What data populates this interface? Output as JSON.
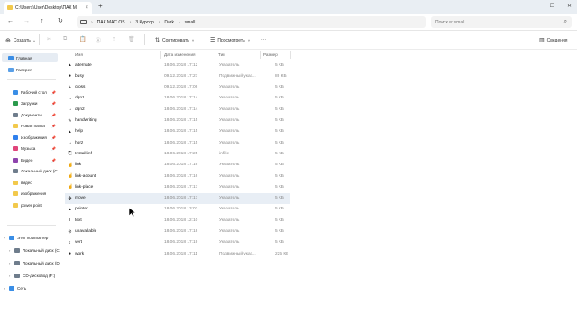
{
  "window": {
    "tab_title": "C:\\Users\\User\\Desktop\\ПАК M",
    "tab_close": "×",
    "new_tab": "+",
    "controls": [
      "—",
      "☐",
      "✕"
    ]
  },
  "address": {
    "breadcrumbs": [
      "ПАК MAC OS",
      "3 Курсор",
      "Dark",
      "small"
    ],
    "search_placeholder": "Поиск в: small"
  },
  "toolbar": {
    "create_label": "Создать",
    "sort_label": "Сортировать",
    "view_label": "Просмотреть",
    "more_label": "···",
    "details_label": "Сведения"
  },
  "sidebar": {
    "quick": [
      {
        "label": "Главная",
        "icon": "home-icon",
        "active": true
      },
      {
        "label": "Галерея",
        "icon": "gallery-icon",
        "active": false
      }
    ],
    "pinned": [
      {
        "label": "Рабочий стол",
        "icon": "desktop-icon",
        "color": "#3a8ee6"
      },
      {
        "label": "Загрузки",
        "icon": "download-icon",
        "color": "#2b9a4d"
      },
      {
        "label": "Документы",
        "icon": "documents-icon",
        "color": "#6f7d8c"
      },
      {
        "label": "Новая папка",
        "icon": "folder-icon",
        "color": "#f2c94c"
      },
      {
        "label": "Изображения",
        "icon": "pictures-icon",
        "color": "#2f80ed"
      },
      {
        "label": "Музыка",
        "icon": "music-icon",
        "color": "#e0457b"
      },
      {
        "label": "Видео",
        "icon": "video-icon",
        "color": "#8e44ad"
      },
      {
        "label": "Локальный диск (C",
        "icon": "drive-icon",
        "color": "#6f7d8c"
      },
      {
        "label": "видео",
        "icon": "folder-icon",
        "color": "#f2c94c"
      },
      {
        "label": "изображения",
        "icon": "folder-icon",
        "color": "#f2c94c"
      },
      {
        "label": "power point",
        "icon": "folder-icon",
        "color": "#f2c94c"
      }
    ],
    "tree": [
      {
        "label": "Этот компьютер",
        "icon": "computer-icon",
        "color": "#3a8ee6",
        "indent": 0,
        "expander": "˅"
      },
      {
        "label": "Локальный диск (C",
        "icon": "drive-icon",
        "color": "#6f7d8c",
        "indent": 1,
        "expander": "›"
      },
      {
        "label": "Локальный диск (D",
        "icon": "drive-icon",
        "color": "#6f7d8c",
        "indent": 1,
        "expander": "›"
      },
      {
        "label": "CD-дисковод (F:)",
        "icon": "cd-drive-icon",
        "color": "#6f7d8c",
        "indent": 1,
        "expander": "›"
      },
      {
        "label": "Сеть",
        "icon": "network-icon",
        "color": "#3a8ee6",
        "indent": 0,
        "expander": "›"
      }
    ]
  },
  "columns": {
    "name": "Имя",
    "date": "Дата изменения",
    "type": "Тип",
    "size": "Размер"
  },
  "files": [
    {
      "glyph": "▴",
      "name": "alternate",
      "date": "18.06.2018 17:12",
      "type": "Указатель",
      "size": "5 КБ"
    },
    {
      "glyph": "●",
      "name": "busy",
      "date": "09.12.2018 17:27",
      "type": "Подвижный указ...",
      "size": "89 КБ"
    },
    {
      "glyph": "+",
      "name": "cross",
      "date": "09.12.2018 17:06",
      "type": "Указатель",
      "size": "5 КБ"
    },
    {
      "glyph": "↔",
      "name": "dgn1",
      "date": "18.06.2018 17:14",
      "type": "Указатель",
      "size": "5 КБ"
    },
    {
      "glyph": "↔",
      "name": "dgn2",
      "date": "18.06.2018 17:14",
      "type": "Указатель",
      "size": "5 КБ"
    },
    {
      "glyph": "✎",
      "name": "handwriting",
      "date": "18.06.2018 17:15",
      "type": "Указатель",
      "size": "5 КБ"
    },
    {
      "glyph": "▴",
      "name": "help",
      "date": "18.06.2018 17:15",
      "type": "Указатель",
      "size": "5 КБ"
    },
    {
      "glyph": "↔",
      "name": "horz",
      "date": "18.06.2018 17:15",
      "type": "Указатель",
      "size": "5 КБ"
    },
    {
      "glyph": "⎘",
      "name": "Install.inf",
      "date": "18.06.2018 17:25",
      "type": "inffile",
      "size": "5 КБ"
    },
    {
      "glyph": "☝",
      "name": "link",
      "date": "18.06.2018 17:16",
      "type": "Указатель",
      "size": "5 КБ"
    },
    {
      "glyph": "☝",
      "name": "link-acount",
      "date": "18.06.2018 17:16",
      "type": "Указатель",
      "size": "5 КБ"
    },
    {
      "glyph": "☝",
      "name": "link-place",
      "date": "18.06.2018 17:17",
      "type": "Указатель",
      "size": "5 КБ"
    },
    {
      "glyph": "✥",
      "name": "move",
      "date": "18.06.2018 17:17",
      "type": "Указатель",
      "size": "5 КБ"
    },
    {
      "glyph": "▴",
      "name": "pointer",
      "date": "18.06.2018 13:03",
      "type": "Указатель",
      "size": "5 КБ"
    },
    {
      "glyph": "I",
      "name": "text",
      "date": "18.06.2018 12:10",
      "type": "Указатель",
      "size": "5 КБ"
    },
    {
      "glyph": "⊘",
      "name": "unavailable",
      "date": "18.06.2018 17:18",
      "type": "Указатель",
      "size": "5 КБ"
    },
    {
      "glyph": "↕",
      "name": "vert",
      "date": "18.06.2018 17:19",
      "type": "Указатель",
      "size": "5 КБ"
    },
    {
      "glyph": "●",
      "name": "work",
      "date": "18.06.2018 17:11",
      "type": "Подвижный указ...",
      "size": "225 КБ"
    }
  ],
  "selected_file": "move"
}
